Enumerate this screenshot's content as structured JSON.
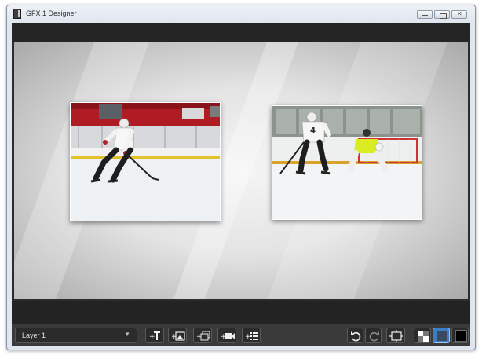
{
  "window": {
    "title": "GFX 1 Designer"
  },
  "toolbar": {
    "layer_select_value": "Layer 1",
    "buttons": [
      "add-text",
      "add-image",
      "add-gallery",
      "add-video",
      "add-list",
      "undo",
      "redo",
      "safe-area",
      "background-checkerboard",
      "background-blue",
      "background-black"
    ]
  },
  "colors": {
    "canvas_light": "#f5f5f5",
    "canvas_dark": "#a9a9a9",
    "toolbar_bg": "#3a3a3a",
    "accent_blue": "#3a7ec6"
  }
}
